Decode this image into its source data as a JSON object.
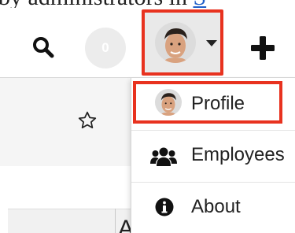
{
  "header": {
    "caption_text": "by administrators in ",
    "caption_link": "S",
    "notification_count": "0"
  },
  "icons": {
    "search": "search-icon",
    "avatar": "user-avatar",
    "caret": "chevron-down-icon",
    "plus": "plus-icon",
    "star": "star-icon",
    "employees": "people-icon",
    "about": "info-icon"
  },
  "dropdown": {
    "items": [
      {
        "label": "Profile"
      },
      {
        "label": "Employees"
      },
      {
        "label": "About"
      }
    ]
  },
  "content": {
    "partial_heading": "A"
  },
  "colors": {
    "highlight": "#e8321f",
    "link": "#1f5fc9",
    "badge_bg": "#ececec"
  }
}
